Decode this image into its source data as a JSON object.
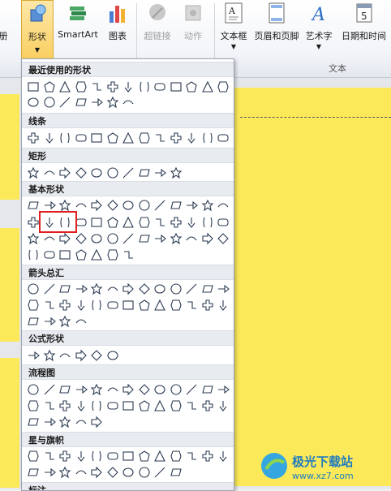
{
  "ribbon": {
    "left_partial": "册",
    "shapes": "形状",
    "smartart": "SmartArt",
    "chart": "图表",
    "hyperlink": "超链接",
    "action": "动作",
    "textbox": "文本框",
    "header_footer": "页眉和页脚",
    "wordart": "艺术字",
    "datetime": "日期和时间",
    "text_group": "文本"
  },
  "gallery": {
    "categories": [
      "最近使用的形状",
      "线条",
      "矩形",
      "基本形状",
      "箭头总汇",
      "公式形状",
      "流程图",
      "星与旗帜",
      "标注"
    ]
  },
  "watermark": {
    "text": "极光下载站",
    "url": "www.xz7.com"
  },
  "colors": {
    "slide_bg": "#fbe95a",
    "highlight": "#e02020",
    "ribbon_bg": "#f2f4f8",
    "accent": "#2b6fc6"
  }
}
